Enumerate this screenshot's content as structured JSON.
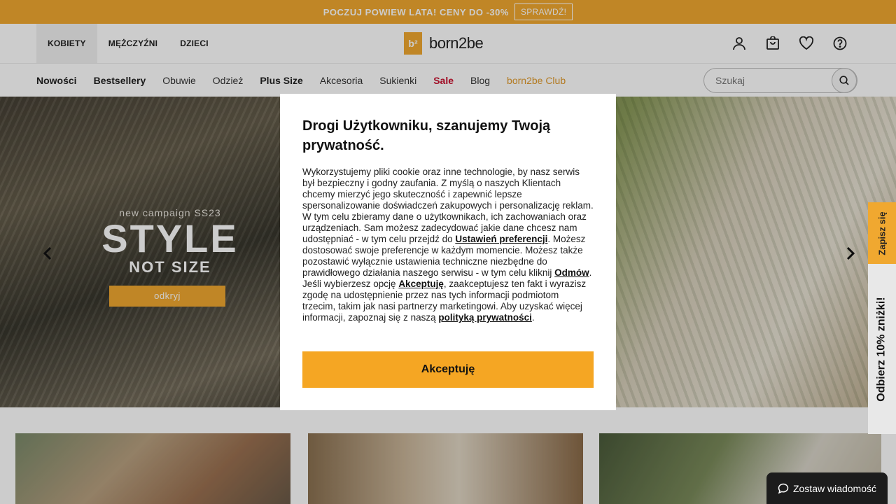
{
  "promo": {
    "text": "POCZUJ POWIEW LATA! CENY DO -30%",
    "button": "SPRAWDŹ!",
    "color": "#f0a830"
  },
  "header": {
    "gender_tabs": [
      {
        "label": "KOBIETY",
        "active": true
      },
      {
        "label": "MĘŻCZYŹNI",
        "active": false
      },
      {
        "label": "DZIECI",
        "active": false
      }
    ],
    "logo_mark": "b²",
    "logo_text": "born2be",
    "icons": [
      "user-icon",
      "cart-icon",
      "heart-icon",
      "help-icon"
    ]
  },
  "nav": {
    "items": [
      {
        "label": "Nowości",
        "style": "bold"
      },
      {
        "label": "Bestsellery",
        "style": "bold"
      },
      {
        "label": "Obuwie",
        "style": "normal"
      },
      {
        "label": "Odzież",
        "style": "normal"
      },
      {
        "label": "Plus Size",
        "style": "bold"
      },
      {
        "label": "Akcesoria",
        "style": "normal"
      },
      {
        "label": "Sukienki",
        "style": "normal"
      },
      {
        "label": "Sale",
        "style": "sale"
      },
      {
        "label": "Blog",
        "style": "normal"
      },
      {
        "label": "born2be Club",
        "style": "club"
      }
    ],
    "search_placeholder": "Szukaj"
  },
  "hero": {
    "campaign": "new campaign SS23",
    "title": "STYLE",
    "subtitle": "NOT SIZE",
    "cta": "odkryj"
  },
  "side": {
    "signup": "Zapisz się",
    "discount": "Odbierz 10% zniżki!"
  },
  "chat": {
    "label": "Zostaw wiadomość"
  },
  "consent": {
    "title": "Drogi Użytkowniku, szanujemy Twoją prywatność.",
    "body_1": "Wykorzystujemy pliki cookie oraz inne technologie, by nasz serwis był bezpieczny i godny zaufania. Z myślą o naszych Klientach chcemy mierzyć jego skuteczność i zapewnić lepsze spersonalizowanie doświadczeń zakupowych i personalizację reklam. W tym celu zbieramy dane o użytkownikach, ich zachowaniach oraz urządzeniach. Sam możesz zadecydować jakie dane chcesz nam udostępniać - w tym celu przejdź do ",
    "link_preferences": "Ustawień preferencji",
    "body_2": ". Możesz dostosować swoje preferencje w każdym momencie. Możesz także pozostawić wyłącznie ustawienia techniczne niezbędne do prawidłowego działania naszego serwisu - w tym celu kliknij ",
    "link_reject": "Odmów",
    "body_3": ". Jeśli wybierzesz opcję ",
    "link_accept": "Akceptuję",
    "body_4": ", zaakceptujesz ten fakt i wyrazisz zgodę na udostępnienie przez nas tych informacji podmiotom trzecim, takim jak nasi partnerzy marketingowi. Aby uzyskać więcej informacji, zapoznaj się z naszą ",
    "link_policy": "polityką prywatności",
    "body_5": ".",
    "accept_button": "Akceptuję",
    "accent": "#f5a623"
  }
}
